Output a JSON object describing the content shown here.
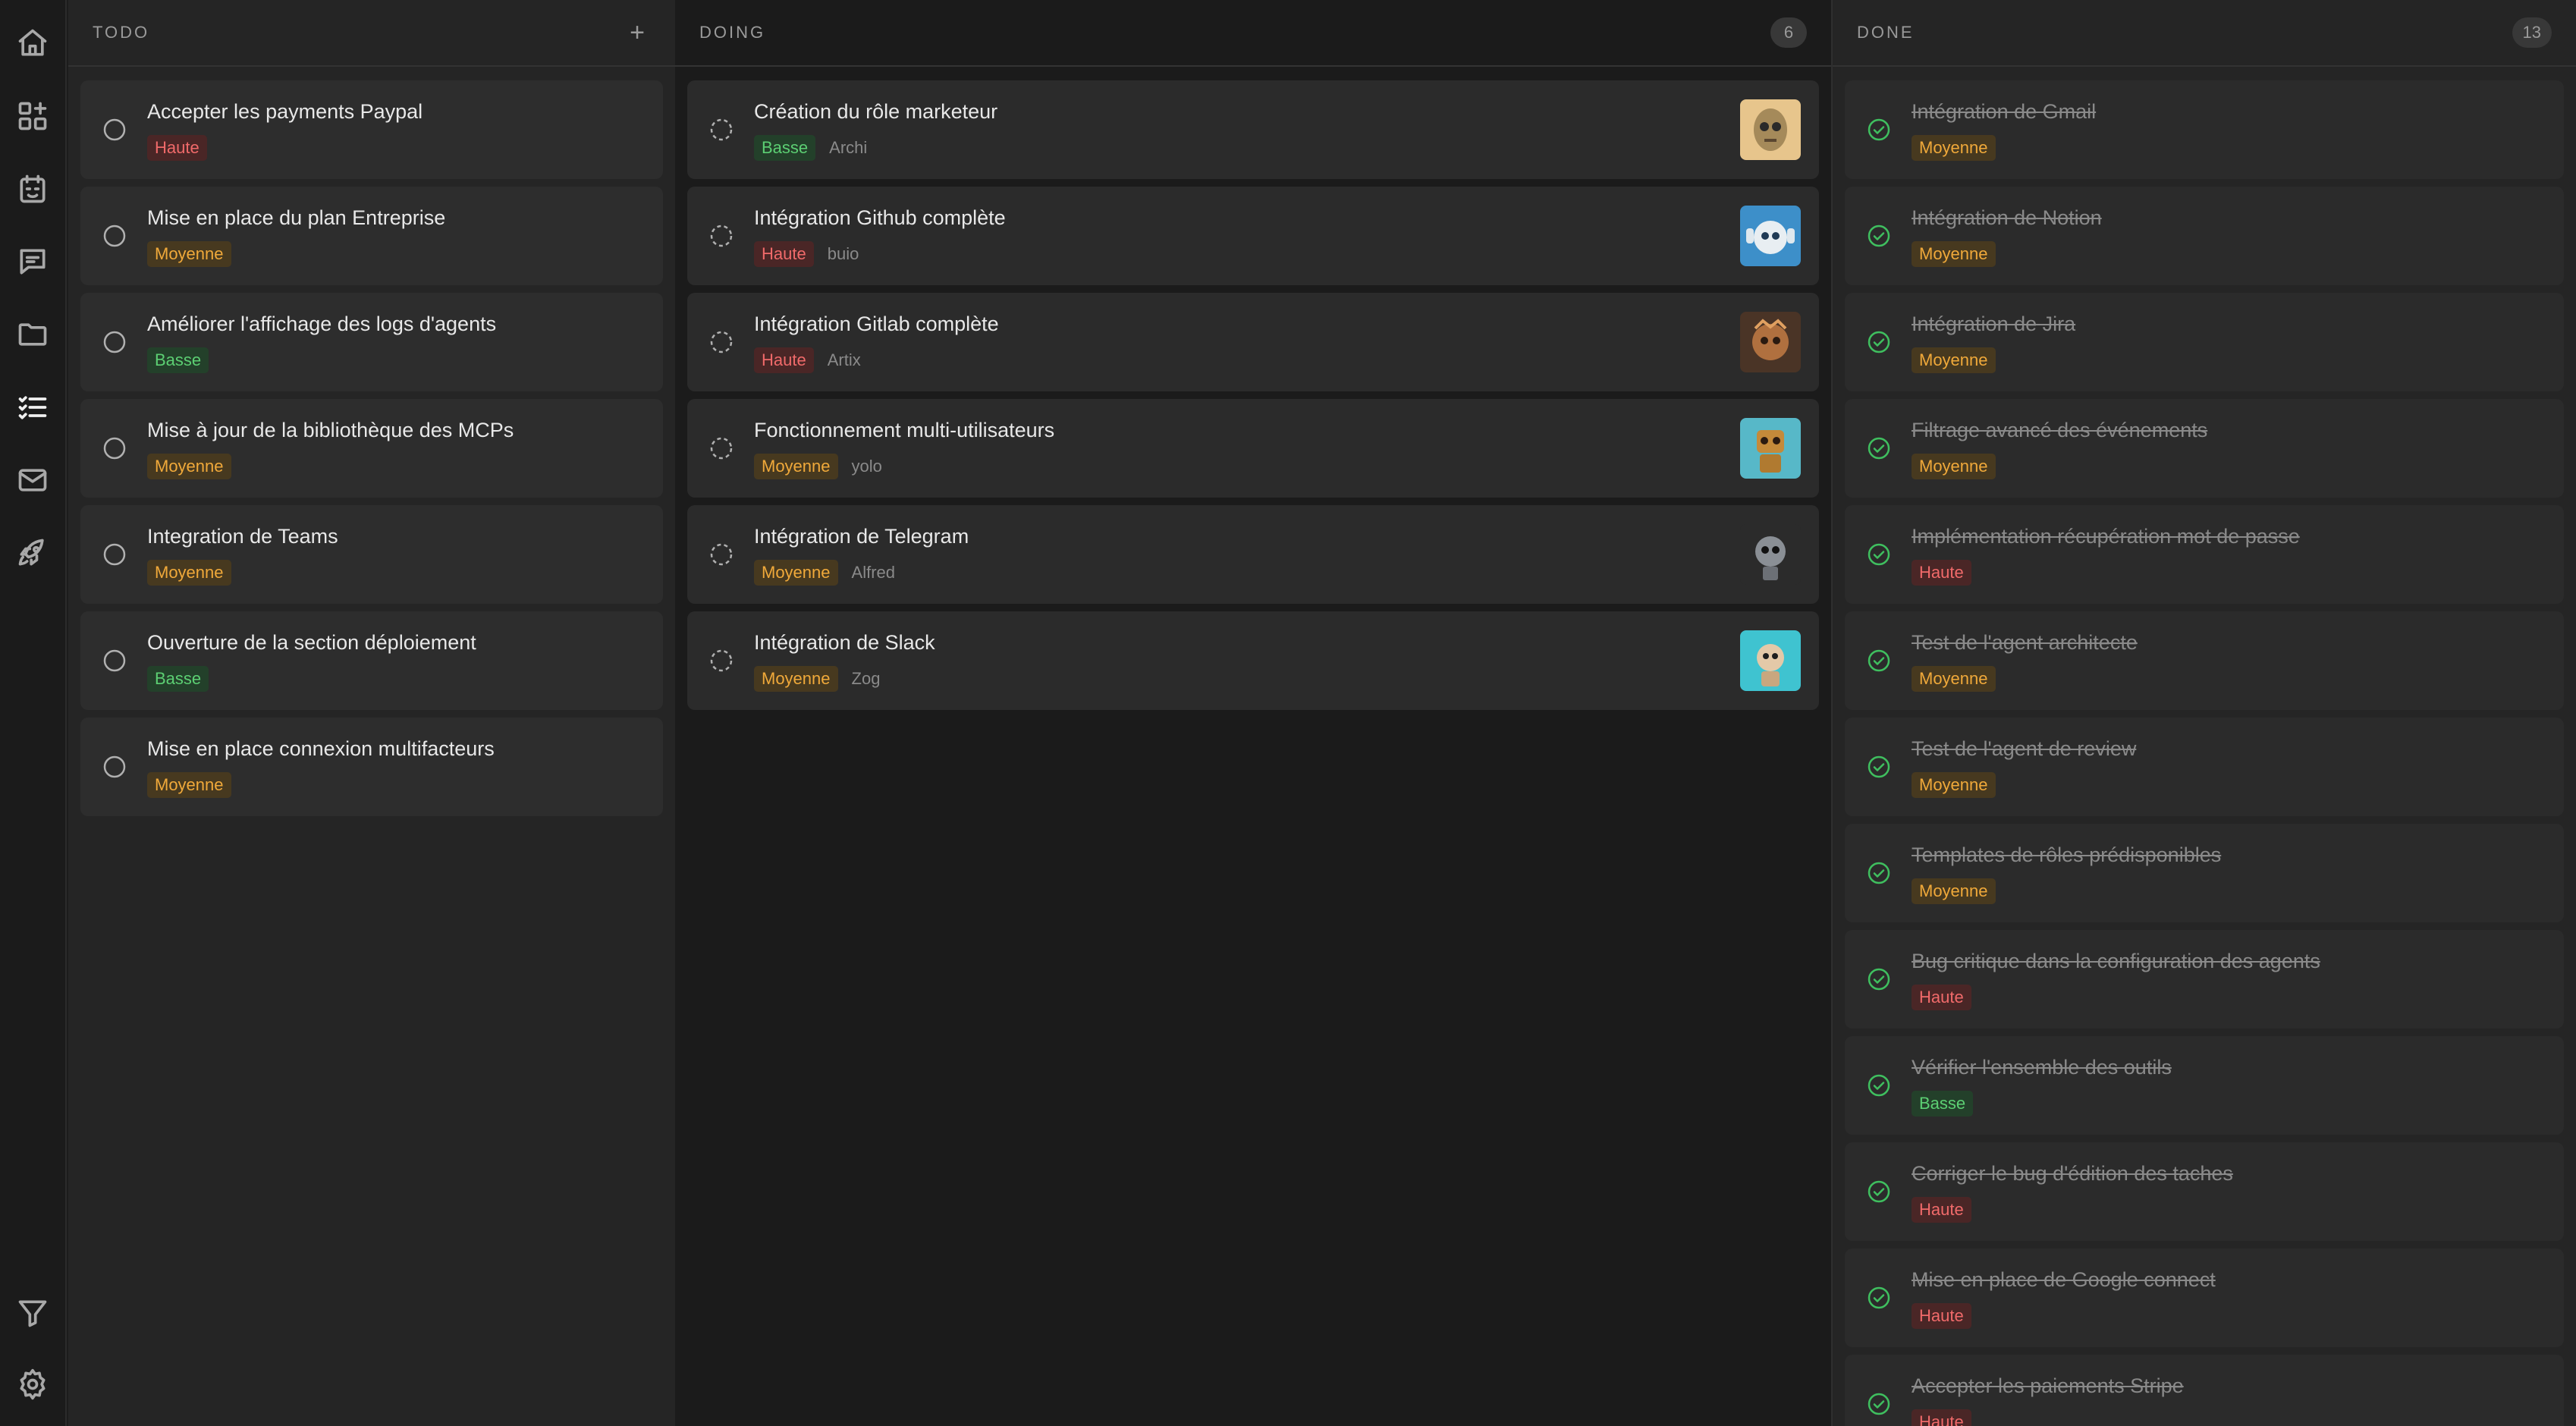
{
  "sidebar": {
    "items": [
      {
        "icon": "home-icon"
      },
      {
        "icon": "dashboard-add-icon"
      },
      {
        "icon": "calendar-icon"
      },
      {
        "icon": "chat-icon"
      },
      {
        "icon": "folder-icon"
      },
      {
        "icon": "task-list-icon"
      },
      {
        "icon": "mail-icon"
      },
      {
        "icon": "rocket-icon"
      }
    ],
    "bottom": [
      {
        "icon": "filter-icon"
      },
      {
        "icon": "settings-icon"
      }
    ]
  },
  "columns": {
    "todo": {
      "title": "TODO",
      "add_label": "+",
      "cards": [
        {
          "title": "Accepter les payments Paypal",
          "priority": "Haute"
        },
        {
          "title": "Mise en place du plan Entreprise",
          "priority": "Moyenne"
        },
        {
          "title": "Améliorer l'affichage des logs d'agents",
          "priority": "Basse"
        },
        {
          "title": "Mise à jour de la bibliothèque des MCPs",
          "priority": "Moyenne"
        },
        {
          "title": "Integration de Teams",
          "priority": "Moyenne"
        },
        {
          "title": "Ouverture de la section déploiement",
          "priority": "Basse"
        },
        {
          "title": "Mise en place connexion multifacteurs",
          "priority": "Moyenne"
        }
      ]
    },
    "doing": {
      "title": "DOING",
      "count": "6",
      "cards": [
        {
          "title": "Création du rôle marketeur",
          "priority": "Basse",
          "assignee": "Archi"
        },
        {
          "title": "Intégration Github complète",
          "priority": "Haute",
          "assignee": "buio"
        },
        {
          "title": "Intégration Gitlab complète",
          "priority": "Haute",
          "assignee": "Artix"
        },
        {
          "title": "Fonctionnement multi-utilisateurs",
          "priority": "Moyenne",
          "assignee": "yolo"
        },
        {
          "title": "Intégration de Telegram",
          "priority": "Moyenne",
          "assignee": "Alfred"
        },
        {
          "title": "Intégration de Slack",
          "priority": "Moyenne",
          "assignee": "Zog"
        }
      ]
    },
    "done": {
      "title": "DONE",
      "count": "13",
      "cards": [
        {
          "title": "Intégration de Gmail",
          "priority": "Moyenne"
        },
        {
          "title": "Intégration de Notion",
          "priority": "Moyenne"
        },
        {
          "title": "Intégration de Jira",
          "priority": "Moyenne"
        },
        {
          "title": "Filtrage avancé des événements",
          "priority": "Moyenne"
        },
        {
          "title": "Implémentation récupération mot de passe",
          "priority": "Haute"
        },
        {
          "title": "Test de l'agent architecte",
          "priority": "Moyenne"
        },
        {
          "title": "Test de l'agent de review",
          "priority": "Moyenne"
        },
        {
          "title": "Templates de rôles prédisponibles",
          "priority": "Moyenne"
        },
        {
          "title": "Bug critique dans la configuration des agents",
          "priority": "Haute"
        },
        {
          "title": "Vérifier l'ensemble des outils",
          "priority": "Basse"
        },
        {
          "title": "Corriger le bug d'édition des taches",
          "priority": "Haute"
        },
        {
          "title": "Mise en place de Google connect",
          "priority": "Haute"
        },
        {
          "title": "Accepter les paiements Stripe",
          "priority": "Haute"
        }
      ]
    }
  },
  "colors": {
    "haute": "#f06a6a",
    "moyenne": "#f0a93a",
    "basse": "#5ccf73",
    "done_check": "#3fbf5f"
  }
}
